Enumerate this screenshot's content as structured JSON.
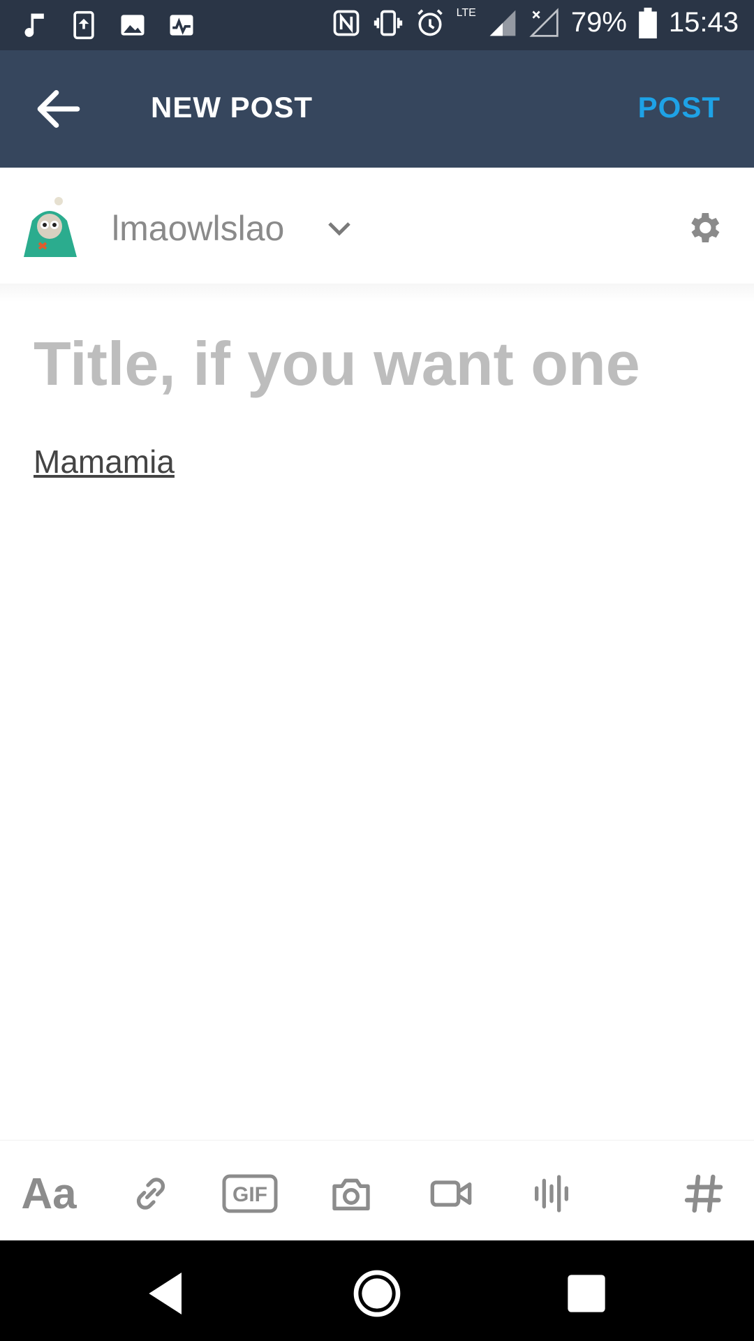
{
  "status_bar": {
    "battery": "79%",
    "time": "15:43",
    "network": "LTE",
    "icons": [
      "music-icon",
      "upload-icon",
      "image-icon",
      "pulse-icon",
      "nfc-icon",
      "vibrate-icon",
      "alarm-icon",
      "signal-icon",
      "no-signal-icon",
      "battery-icon"
    ]
  },
  "app_bar": {
    "title": "NEW POST",
    "post_label": "POST",
    "back_icon": "arrow-left-icon",
    "post_color": "#1ea2e6",
    "background": "#36465d"
  },
  "user": {
    "blog_name": "lmaowlslao",
    "avatar": "owl-avatar",
    "chevron": "chevron-down-icon",
    "settings_icon": "gear-icon"
  },
  "editor": {
    "title_placeholder": "Title, if you want one",
    "body_text": "Mamamia"
  },
  "toolbar": {
    "text_style_label": "Aa",
    "gif_label": "GIF",
    "icons": [
      "text-style-icon",
      "link-icon",
      "gif-icon",
      "camera-icon",
      "video-icon",
      "audio-icon",
      "hashtag-icon"
    ]
  },
  "nav_bar": {
    "icons": [
      "back-triangle-icon",
      "home-circle-icon",
      "recents-square-icon"
    ]
  }
}
